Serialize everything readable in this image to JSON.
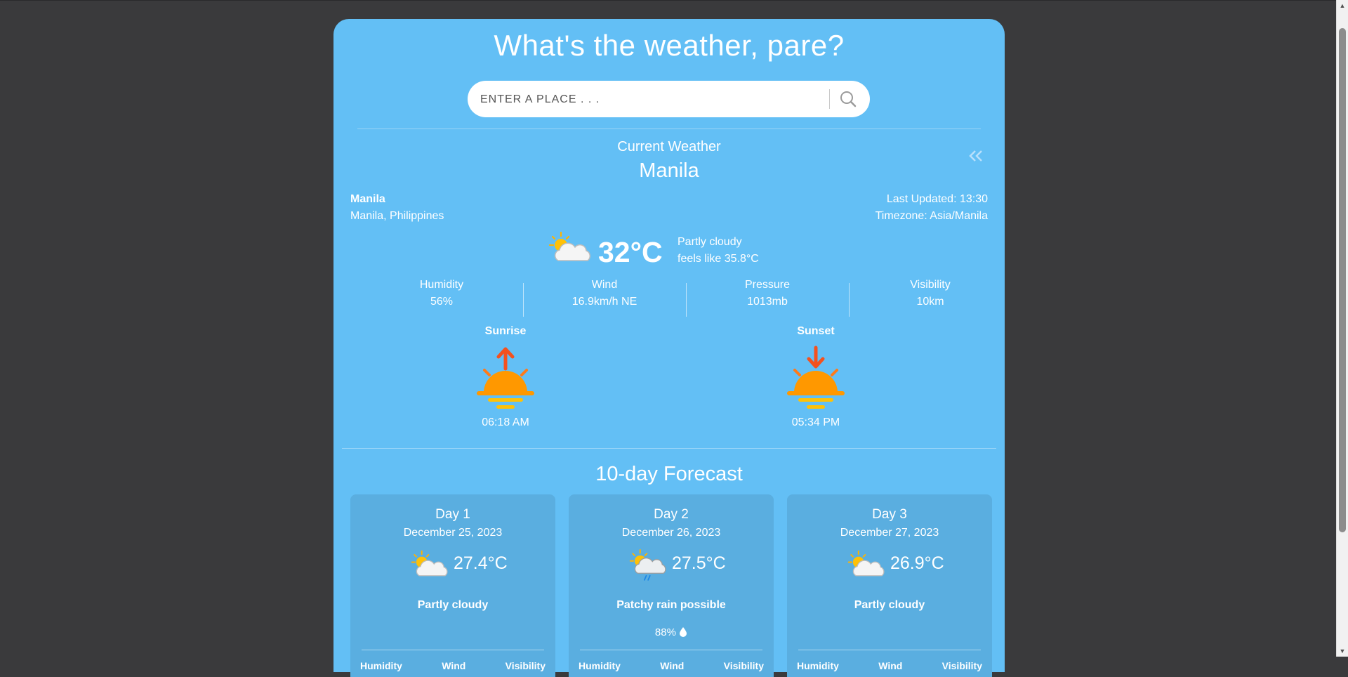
{
  "app": {
    "title": "What's the weather, pare?",
    "search_placeholder": "ENTER A PLACE . . ."
  },
  "current": {
    "section_label": "Current Weather",
    "city": "Manila",
    "location_name": "Manila",
    "location_full": "Manila, Philippines",
    "last_updated": "Last Updated: 13:30",
    "timezone": "Timezone: Asia/Manila",
    "icon": "partly-cloudy-icon",
    "temperature": "32°C",
    "condition": "Partly cloudy",
    "feels_like": "feels like 35.8°C",
    "stats": [
      {
        "label": "Humidity",
        "value": "56%"
      },
      {
        "label": "Wind",
        "value": "16.9km/h NE"
      },
      {
        "label": "Pressure",
        "value": "1013mb"
      },
      {
        "label": "Visibility",
        "value": "10km"
      }
    ],
    "sunrise": {
      "label": "Sunrise",
      "time": "06:18 AM"
    },
    "sunset": {
      "label": "Sunset",
      "time": "05:34 PM"
    }
  },
  "forecast": {
    "title": "10-day Forecast",
    "days": [
      {
        "day": "Day 1",
        "date": "December 25, 2023",
        "temp": "27.4°C",
        "condition": "Partly cloudy",
        "rain": "",
        "icon": "partly-cloudy-icon"
      },
      {
        "day": "Day 2",
        "date": "December 26, 2023",
        "temp": "27.5°C",
        "condition": "Patchy rain possible",
        "rain": "88%",
        "icon": "patchy-rain-icon"
      },
      {
        "day": "Day 3",
        "date": "December 27, 2023",
        "temp": "26.9°C",
        "condition": "Partly cloudy",
        "rain": "",
        "icon": "partly-cloudy-icon"
      }
    ],
    "stat_labels": [
      "Humidity",
      "Wind",
      "Visibility"
    ]
  },
  "colors": {
    "page_background": "#3a3a3c",
    "card_background": "#63bff5",
    "forecast_card": "#5aaee0",
    "sun_orange": "#ff9800",
    "arrow_orange": "#f4511e"
  }
}
